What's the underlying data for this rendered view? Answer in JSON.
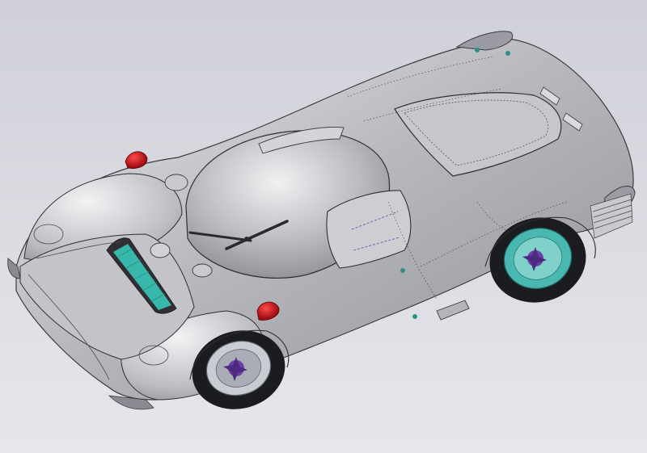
{
  "viewport": {
    "background_top": "#cfd0d8",
    "background_bottom": "#e6e7ec"
  },
  "model": {
    "body_color": "#b7b8bd",
    "body_highlight": "#eeeef0",
    "line_color": "#3a3a40",
    "wheel_accent_front": "#49b8b0",
    "wheel_accent_rear": "#c9ccd3",
    "hub_color": "#6a3fa8",
    "light_color": "#c0101a",
    "radiator_accent": "#39c8b8",
    "tire_color": "#1b1c1f"
  }
}
